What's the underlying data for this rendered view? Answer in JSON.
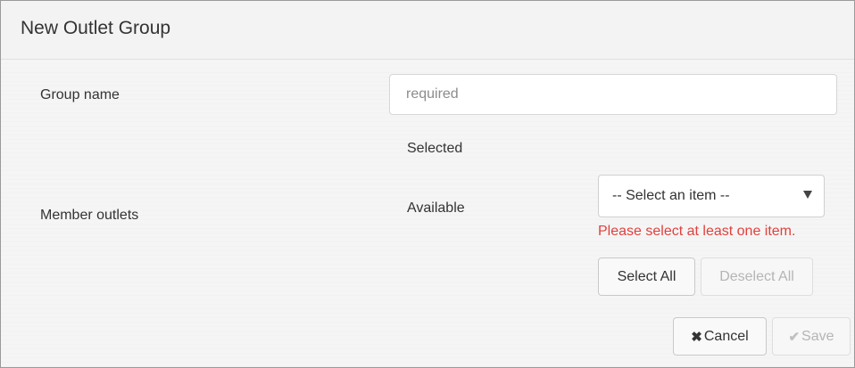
{
  "dialog": {
    "title": "New Outlet Group"
  },
  "form": {
    "group_name_label": "Group name",
    "group_name_placeholder": "required",
    "group_name_value": "",
    "member_outlets_label": "Member outlets",
    "selected_label": "Selected",
    "available_label": "Available",
    "available_select_value": "-- Select an item --",
    "error_text": "Please select at least one item."
  },
  "buttons": {
    "select_all": "Select All",
    "deselect_all": "Deselect All",
    "cancel": "Cancel",
    "save": "Save"
  },
  "icons": {
    "cancel_icon": "close-icon",
    "save_icon": "check-icon",
    "dropdown_icon": "caret-down-icon"
  },
  "colors": {
    "error": "#e0413d",
    "panel_background": "#f5f5f5"
  }
}
